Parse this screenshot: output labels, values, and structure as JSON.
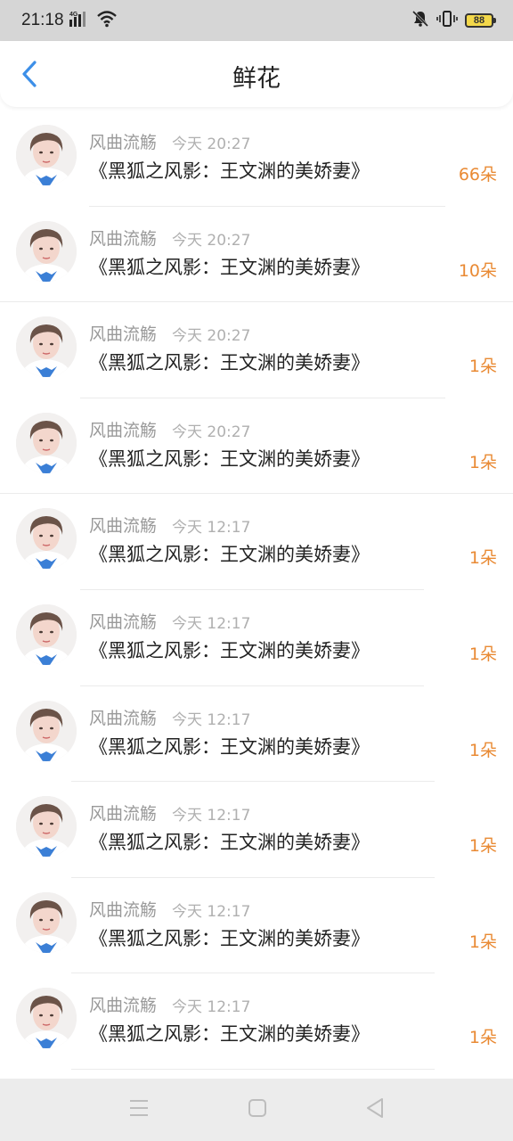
{
  "status_bar": {
    "time": "21:18",
    "battery": "88",
    "signal_icon": "signal-4g-icon",
    "wifi_icon": "wifi-icon",
    "silent_icon": "bell-off-icon",
    "vibrate_icon": "vibrate-icon"
  },
  "header": {
    "title": "鲜花",
    "back_icon": "chevron-left-icon",
    "accent_color": "#3d8fe8"
  },
  "items": [
    {
      "user": "风曲流觞",
      "time": "今天 20:27",
      "title": "《黑狐之风影：王文渊的美娇妻》",
      "count": "66朵"
    },
    {
      "user": "风曲流觞",
      "time": "今天 20:27",
      "title": "《黑狐之风影：王文渊的美娇妻》",
      "count": "10朵"
    },
    {
      "user": "风曲流觞",
      "time": "今天 20:27",
      "title": "《黑狐之风影：王文渊的美娇妻》",
      "count": "1朵"
    },
    {
      "user": "风曲流觞",
      "time": "今天 20:27",
      "title": "《黑狐之风影：王文渊的美娇妻》",
      "count": "1朵"
    },
    {
      "user": "风曲流觞",
      "time": "今天 12:17",
      "title": "《黑狐之风影：王文渊的美娇妻》",
      "count": "1朵"
    },
    {
      "user": "风曲流觞",
      "time": "今天 12:17",
      "title": "《黑狐之风影：王文渊的美娇妻》",
      "count": "1朵"
    },
    {
      "user": "风曲流觞",
      "time": "今天 12:17",
      "title": "《黑狐之风影：王文渊的美娇妻》",
      "count": "1朵"
    },
    {
      "user": "风曲流觞",
      "time": "今天 12:17",
      "title": "《黑狐之风影：王文渊的美娇妻》",
      "count": "1朵"
    },
    {
      "user": "风曲流觞",
      "time": "今天 12:17",
      "title": "《黑狐之风影：王文渊的美娇妻》",
      "count": "1朵"
    },
    {
      "user": "风曲流觞",
      "time": "今天 12:17",
      "title": "《黑狐之风影：王文渊的美娇妻》",
      "count": "1朵"
    }
  ],
  "count_color": "#e98a34",
  "system_nav": {
    "menu_icon": "menu-icon",
    "home_icon": "home-square-icon",
    "back_icon": "back-triangle-icon"
  }
}
